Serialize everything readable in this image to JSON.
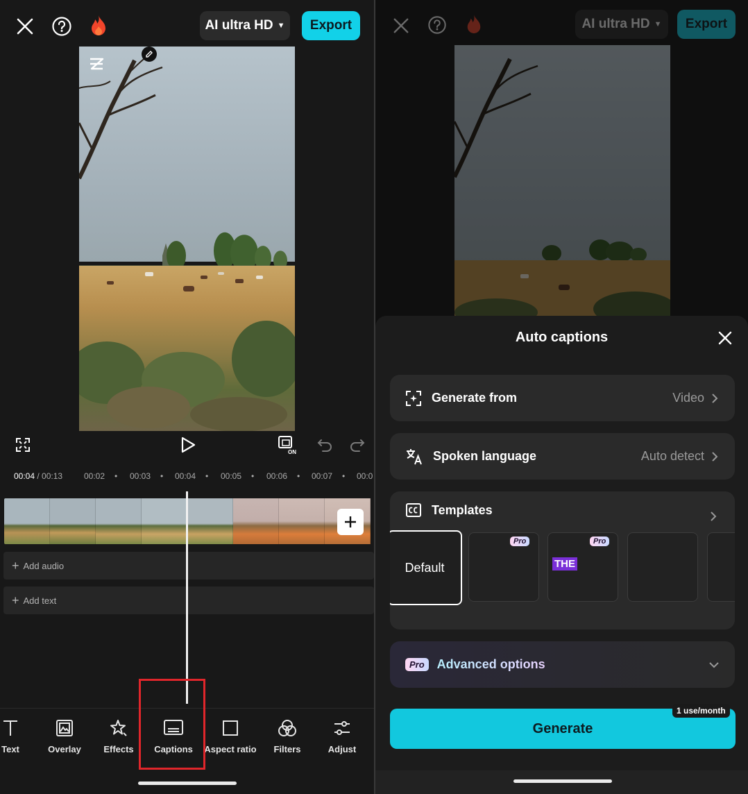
{
  "editor": {
    "quality_label": "AI ultra HD",
    "export_label": "Export",
    "timecode_current": "00:04",
    "timecode_total": " / 00:13",
    "ruler_marks": [
      "00:02",
      "00:03",
      "00:04",
      "00:05",
      "00:06",
      "00:07",
      "00:0"
    ],
    "track_add_audio": "Add audio",
    "track_add_text": "Add text",
    "toolbar": [
      {
        "label": "Text",
        "icon": "text-icon"
      },
      {
        "label": "Overlay",
        "icon": "overlay-icon"
      },
      {
        "label": "Effects",
        "icon": "effects-icon"
      },
      {
        "label": "Captions",
        "icon": "captions-icon"
      },
      {
        "label": "Aspect ratio",
        "icon": "aspect-ratio-icon"
      },
      {
        "label": "Filters",
        "icon": "filters-icon"
      },
      {
        "label": "Adjust",
        "icon": "adjust-icon"
      }
    ],
    "highlight_color": "#e0262b"
  },
  "auto_captions": {
    "title": "Auto captions",
    "generate_from": {
      "label": "Generate from",
      "value": "Video"
    },
    "spoken_language": {
      "label": "Spoken language",
      "value": "Auto detect"
    },
    "templates": {
      "label": "Templates",
      "items": [
        {
          "label": "Default",
          "selected": true
        },
        {
          "label": "",
          "badge": "Pro"
        },
        {
          "label": "THE",
          "badge": "Pro"
        },
        {
          "label": ""
        }
      ]
    },
    "advanced": {
      "badge": "Pro",
      "label": "Advanced options"
    },
    "generate_label": "Generate",
    "usage_badge": "1 use/month",
    "accent_color": "#12c8de"
  }
}
